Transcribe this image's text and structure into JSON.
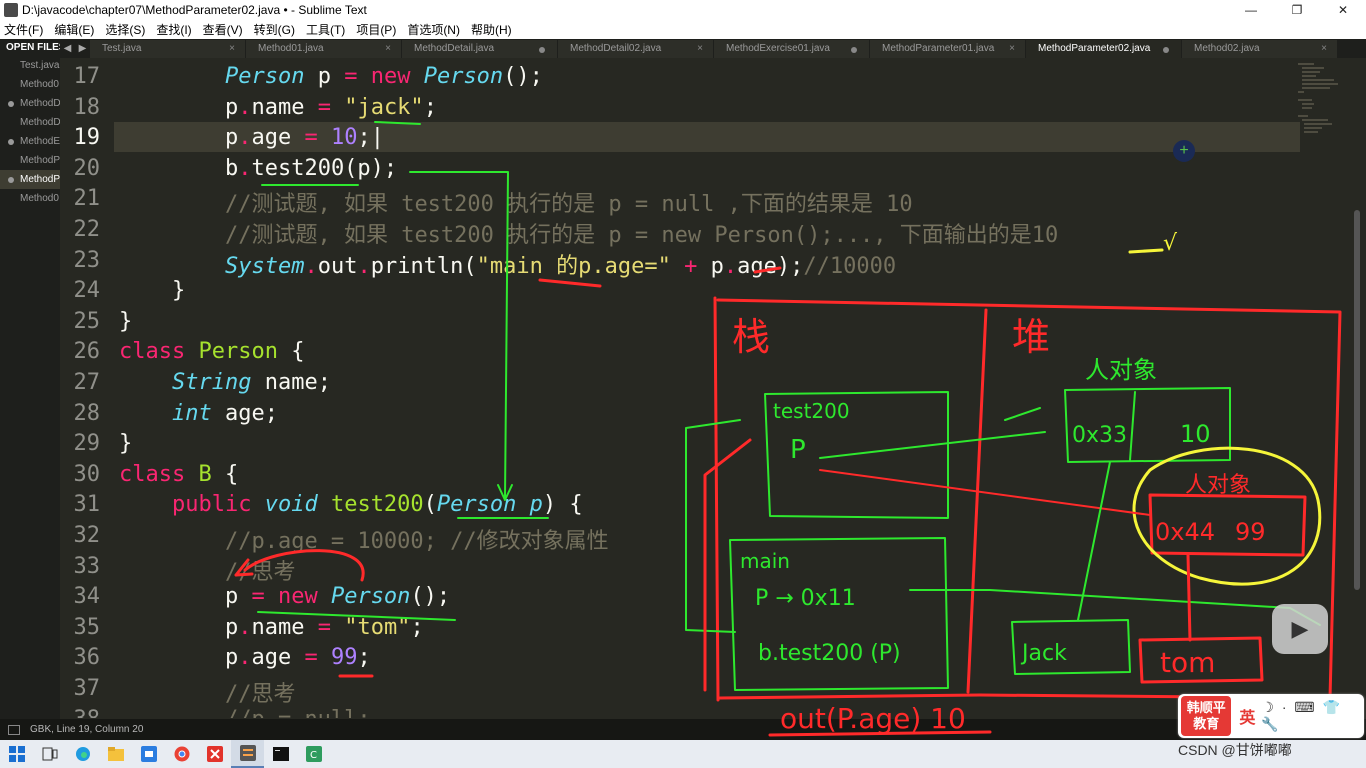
{
  "window": {
    "title": "D:\\javacode\\chapter07\\MethodParameter02.java • - Sublime Text",
    "minimize": "—",
    "maximize": "❐",
    "close": "✕"
  },
  "menu": [
    "文件(F)",
    "编辑(E)",
    "选择(S)",
    "查找(I)",
    "查看(V)",
    "转到(G)",
    "工具(T)",
    "项目(P)",
    "首选项(N)",
    "帮助(H)"
  ],
  "sidebar": {
    "header": "OPEN FILES",
    "files": [
      {
        "label": "Test.java",
        "dirty": false,
        "active": false
      },
      {
        "label": "Method0",
        "dirty": false,
        "active": false
      },
      {
        "label": "MethodD",
        "dirty": true,
        "active": false
      },
      {
        "label": "MethodD",
        "dirty": false,
        "active": false
      },
      {
        "label": "MethodE",
        "dirty": true,
        "active": false
      },
      {
        "label": "MethodP",
        "dirty": false,
        "active": false
      },
      {
        "label": "MethodP",
        "dirty": true,
        "active": true
      },
      {
        "label": "Method0",
        "dirty": false,
        "active": false
      }
    ]
  },
  "tabs": [
    {
      "label": "Test.java",
      "state": "close",
      "active": false
    },
    {
      "label": "Method01.java",
      "state": "close",
      "active": false
    },
    {
      "label": "MethodDetail.java",
      "state": "dirty",
      "active": false
    },
    {
      "label": "MethodDetail02.java",
      "state": "close",
      "active": false
    },
    {
      "label": "MethodExercise01.java",
      "state": "dirty",
      "active": false
    },
    {
      "label": "MethodParameter01.java",
      "state": "close",
      "active": false
    },
    {
      "label": "MethodParameter02.java",
      "state": "dirty",
      "active": true
    },
    {
      "label": "Method02.java",
      "state": "close",
      "active": false
    }
  ],
  "editor": {
    "current_line": "19",
    "lines": [
      {
        "n": "17",
        "html": "        <span class=\"ty\">Person</span> p <span class=\"op\">=</span> <span class=\"kw\">new</span> <span class=\"ty\">Person</span>();"
      },
      {
        "n": "18",
        "html": "        p<span class=\"op\">.</span>name <span class=\"op\">=</span> <span class=\"st\">\"jack\"</span>;"
      },
      {
        "n": "19",
        "html": "        p<span class=\"op\">.</span>age <span class=\"op\">=</span> <span class=\"nu\">10</span>;|"
      },
      {
        "n": "20",
        "html": "        b<span class=\"op\">.</span>test200(p);"
      },
      {
        "n": "21",
        "html": "        <span class=\"cm\">//测试题, 如果 test200 执行的是 p = null ,下面的结果是 10</span>"
      },
      {
        "n": "22",
        "html": "        <span class=\"cm\">//测试题, 如果 test200 执行的是 p = new Person();..., 下面输出的是10</span>"
      },
      {
        "n": "23",
        "html": "        <span class=\"ty\">System</span><span class=\"op\">.</span>out<span class=\"op\">.</span>println(<span class=\"st\">\"main 的p.age=\"</span> <span class=\"op\">+</span> p<span class=\"op\">.</span>age);<span class=\"cm\">//10000</span>"
      },
      {
        "n": "24",
        "html": "    }"
      },
      {
        "n": "25",
        "html": "}"
      },
      {
        "n": "26",
        "html": "<span class=\"kw\">class</span> <span class=\"cl\">Person</span> {"
      },
      {
        "n": "27",
        "html": "    <span class=\"ty\">String</span> name;"
      },
      {
        "n": "28",
        "html": "    <span class=\"ty\">int</span> age;"
      },
      {
        "n": "29",
        "html": "}"
      },
      {
        "n": "30",
        "html": "<span class=\"kw\">class</span> <span class=\"cl\">B</span> {"
      },
      {
        "n": "31",
        "html": "    <span class=\"kw\">public</span> <span class=\"ty\">void</span> <span class=\"cl\">test200</span>(<span class=\"ty\">Person</span> <span class=\"ty\">p</span>) {"
      },
      {
        "n": "32",
        "html": "        <span class=\"cm\">//p.age = 10000; //修改对象属性</span>"
      },
      {
        "n": "33",
        "html": "        <span class=\"cm\">//思考</span>"
      },
      {
        "n": "34",
        "html": "        p <span class=\"op\">=</span> <span class=\"kw\">new</span> <span class=\"ty\">Person</span>();"
      },
      {
        "n": "35",
        "html": "        p<span class=\"op\">.</span>name <span class=\"op\">=</span> <span class=\"st\">\"tom\"</span>;"
      },
      {
        "n": "36",
        "html": "        p<span class=\"op\">.</span>age <span class=\"op\">=</span> <span class=\"nu\">99</span>;"
      },
      {
        "n": "37",
        "html": "        <span class=\"cm\">//思考</span>"
      },
      {
        "n": "38",
        "html": "        <span class=\"cm\">//p = null;</span>"
      }
    ]
  },
  "statusbar": {
    "text": "GBK, Line 19, Column 20"
  },
  "annotations": {
    "stack_label": "栈",
    "heap_label": "堆",
    "object_label": "人对象",
    "frame_test200": "test200",
    "frame_test200_p": "P",
    "frame_main": "main",
    "frame_main_p": "P → 0x11",
    "frame_main_call": "b.test200 (P)",
    "obj1_addr": "0x33",
    "obj1_age": "10",
    "obj2_addr": "0x44",
    "obj2_age": "99",
    "obj1_name": "Jack",
    "obj2_name": "tom",
    "output": "out(P.age) 10",
    "check_mark": "√"
  },
  "watermark": {
    "logo_top": "韩顺平",
    "logo_bottom": "教育",
    "ime": "英",
    "csdn": "CSDN @甘饼嘟嘟"
  },
  "colors": {
    "editor_bg": "#272822",
    "ink_red": "#ff2a2a",
    "ink_green": "#2ee82e",
    "ink_yellow": "#f5f53a"
  }
}
